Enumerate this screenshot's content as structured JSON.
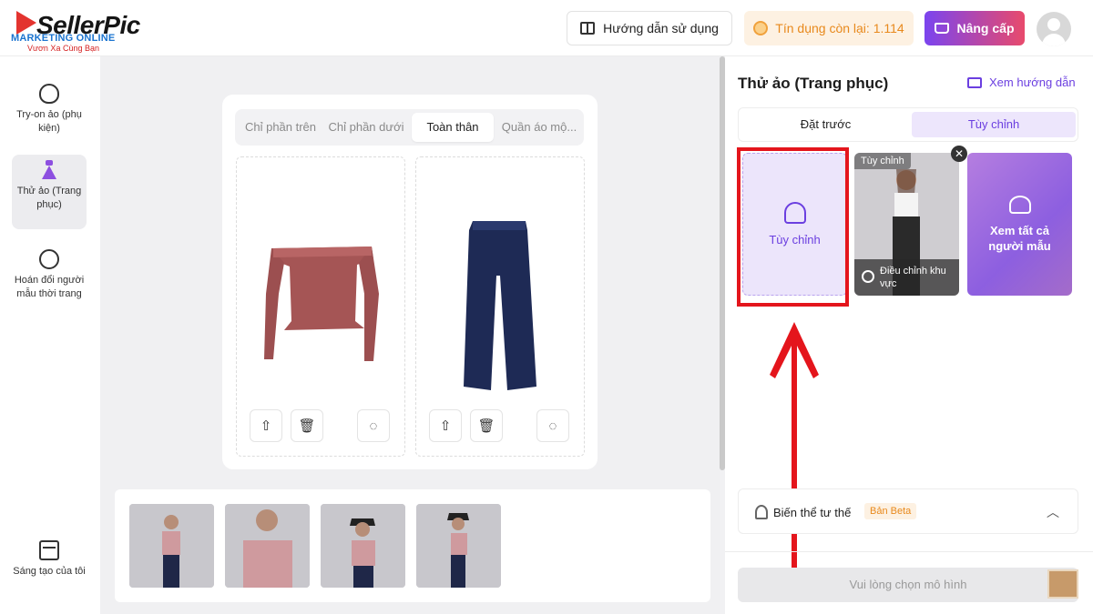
{
  "header": {
    "brand": "SellerPic",
    "watermark_line1": "MARKETING ONLINE",
    "watermark_line2": "Vươn Xa Cùng Bạn",
    "guide_label": "Hướng dẫn sử dụng",
    "credit_label": "Tín dụng còn lại: 1.114",
    "upgrade_label": "Nâng cấp"
  },
  "leftnav": {
    "items": [
      {
        "label": "Try-on ảo (phụ kiện)",
        "icon": "accessory-icon"
      },
      {
        "label": "Thử ảo (Trang phục)",
        "icon": "dress-icon",
        "active": true
      },
      {
        "label": "Hoán đổi người mẫu thời trang",
        "icon": "model-swap-icon"
      },
      {
        "label": "Sáng tạo của tôi",
        "icon": "my-creations-icon"
      }
    ]
  },
  "workspace": {
    "tabs": [
      "Chỉ phần trên",
      "Chỉ phần dưới",
      "Toàn thân",
      "Quần áo mộ..."
    ],
    "active_tab": "Toàn thân",
    "slots": [
      {
        "item": "off-shoulder-top"
      },
      {
        "item": "jeans"
      }
    ]
  },
  "right": {
    "title": "Thử ảo (Trang phục)",
    "guide_link": "Xem hướng dẫn",
    "segments": [
      "Đặt trước",
      "Tùy chỉnh"
    ],
    "active_segment": "Tùy chỉnh",
    "card_custom_label": "Tùy chỉnh",
    "card_model_badge": "Tùy chỉnh",
    "card_model_caption": "Điều chỉnh khu vực",
    "card_all_label": "Xem tất cả người mẫu",
    "pose_label": "Biến thể tư thế",
    "pose_badge": "Bản Beta",
    "generate_placeholder": "Vui lòng chọn mô hình"
  },
  "colors": {
    "accent": "#6b3fe0",
    "highlight": "#e4151c",
    "credit": "#e8891c"
  }
}
